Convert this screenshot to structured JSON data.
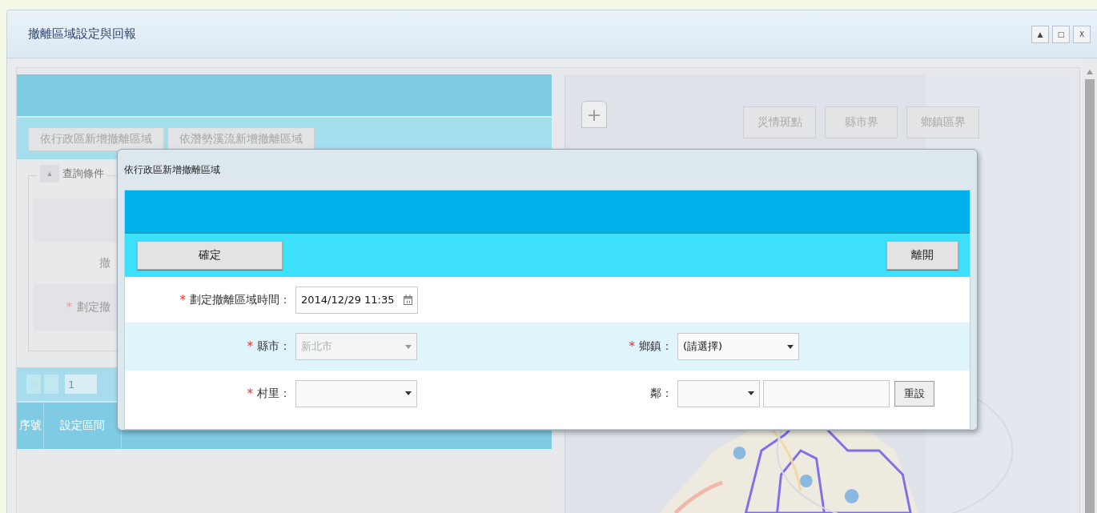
{
  "window": {
    "title": "撤離區域設定與回報",
    "controls": [
      "▲",
      "□",
      "X"
    ]
  },
  "left_panel": {
    "tool_buttons": [
      "依行政區新增撤離區域",
      "依潛勢溪流新增撤離區域"
    ],
    "query": {
      "toggle": "▲",
      "legend": "查詢條件",
      "fields": [
        {
          "label": "撤"
        },
        {
          "label": "劃定撤",
          "mark": "*"
        }
      ]
    },
    "pager": {
      "page": "1"
    },
    "table": {
      "columns": [
        "序號",
        "設定區間"
      ]
    }
  },
  "map": {
    "zoom_in": "+",
    "layer_buttons": [
      "災情斑點",
      "縣市界",
      "鄉鎮區界"
    ]
  },
  "dialog": {
    "title": "依行政區新增撤離區域",
    "confirm": "確定",
    "leave": "離開",
    "rows": [
      {
        "fields": [
          {
            "kind": "datetime",
            "label": "劃定撤離區域時間：",
            "mark": "*",
            "value": "2014/12/29 11:35"
          }
        ]
      },
      {
        "fields": [
          {
            "kind": "select",
            "label": "縣市：",
            "mark": "*",
            "value": "新北市",
            "disabled": true
          },
          {
            "kind": "select",
            "label": "鄉鎮：",
            "mark": "*",
            "value": "(請選擇)",
            "disabled": false
          }
        ]
      },
      {
        "fields": [
          {
            "kind": "select",
            "label": "村里：",
            "mark": "*",
            "disabled": false
          },
          {
            "kind": "select_text",
            "label": "鄰：",
            "button": "重設"
          }
        ]
      }
    ]
  }
}
